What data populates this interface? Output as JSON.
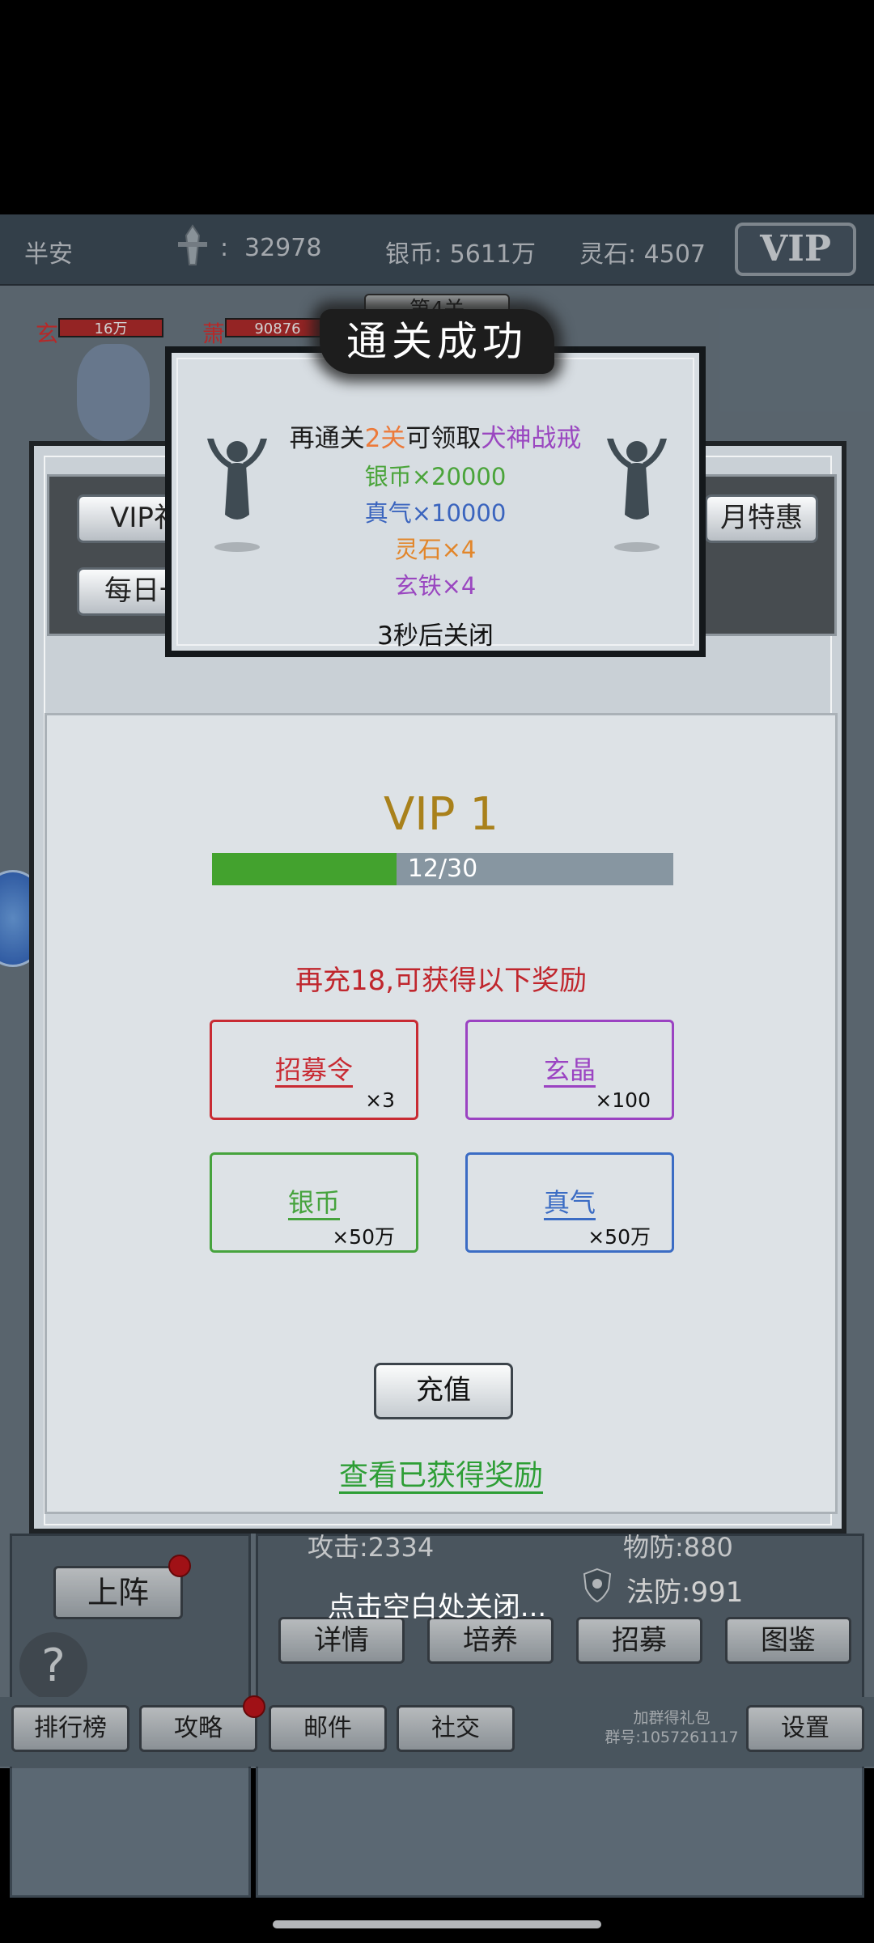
{
  "topbar": {
    "player_name": "半安",
    "power_sep": ":",
    "power": "32978",
    "silver": "银币: 5611万",
    "spirit_stone": "灵石: 4507",
    "vip_label": "VIP"
  },
  "heroes": [
    {
      "letter": "玄",
      "hp_text": "16万"
    },
    {
      "letter": "萧",
      "hp_text": "90876"
    }
  ],
  "stage_banner": "第4关",
  "unit_stats": {
    "attack": "攻击:2334",
    "phys_def": "物防:880",
    "magic_def": "法防:991"
  },
  "deploy_button": "上阵",
  "help_icon_text": "?",
  "unit_buttons": [
    "详情",
    "培养",
    "招募",
    "图鉴"
  ],
  "bottom_nav": [
    "排行榜",
    "攻略",
    "邮件",
    "社交"
  ],
  "group_info": {
    "line1": "加群得礼包",
    "line2": "群号:1057261117"
  },
  "settings_button": "设置",
  "close_hint": "点击空白处关闭...",
  "vip_dialog": {
    "tabs": [
      "VIP礼",
      "每日一",
      "月特惠"
    ],
    "title": "VIP 1",
    "progress_text": "12/30",
    "progress_value": 0.4,
    "promo": "再充18,可获得以下奖励",
    "rewards": [
      {
        "name": "招募令",
        "qty": "×3",
        "color": "#c82b33"
      },
      {
        "name": "玄晶",
        "qty": "×100",
        "color": "#9b43c2"
      },
      {
        "name": "银币",
        "qty": "×50万",
        "color": "#46a33d"
      },
      {
        "name": "真气",
        "qty": "×50万",
        "color": "#3b6cc4"
      }
    ],
    "recharge_button": "充值",
    "view_rewards_link": "查看已获得奖励"
  },
  "clear_popup": {
    "banner": "通关成功",
    "goal_prefix": "再通关",
    "goal_count": "2关",
    "goal_mid": "可领取",
    "goal_item": "犬神战戒",
    "rewards": [
      {
        "text": "银币×20000",
        "color": "#4aa43a"
      },
      {
        "text": "真气×10000",
        "color": "#3a64be"
      },
      {
        "text": "灵石×4",
        "color": "#e2862b"
      },
      {
        "text": "玄铁×4",
        "color": "#9a47c0"
      }
    ],
    "countdown": "3秒后关闭"
  }
}
